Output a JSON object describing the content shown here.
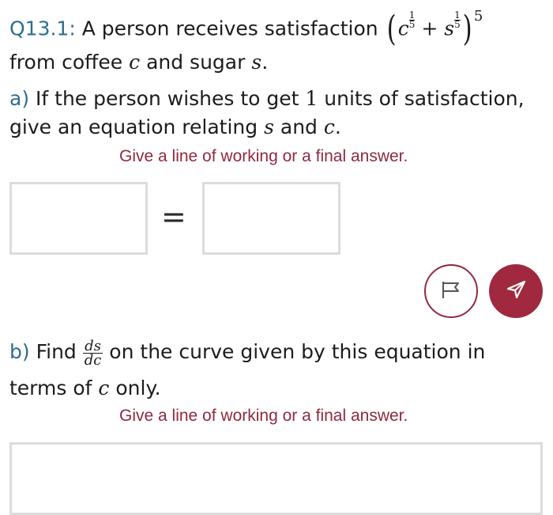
{
  "question": {
    "number": "Q13.1:",
    "intro": " A person receives satisfaction ",
    "expr": {
      "c": "c",
      "s": "s",
      "plus": "+",
      "frac_num": "1",
      "frac_den": "5",
      "outer_exp": "5"
    },
    "line2_a": "from coffee ",
    "line2_c": "c",
    "line2_b": " and sugar ",
    "line2_s": "s",
    "line2_end": "."
  },
  "part_a": {
    "label": "a)",
    "text1": " If the person wishes to get ",
    "value": "1",
    "text2": " units of satisfaction,",
    "line2_a": "give an equation relating ",
    "var_s": "s",
    "line2_b": " and ",
    "var_c": "c",
    "line2_end": ".",
    "hint": "Give a line of working or a final answer.",
    "equals": "="
  },
  "part_b": {
    "label": "b)",
    "text1": " Find ",
    "deriv_num": "ds",
    "deriv_den": "dc",
    "text2": " on the curve given by this equation in",
    "line2_a": "terms of ",
    "var_c": "c",
    "line2_b": " only.",
    "hint": "Give a line of working or a final answer."
  },
  "buttons": {
    "flag_icon": "flag-icon",
    "send_icon": "send-icon"
  },
  "colors": {
    "accent": "#a0293f",
    "hint": "#8f2941",
    "label": "#2e6e8e",
    "box_border": "#dcdcdc"
  }
}
